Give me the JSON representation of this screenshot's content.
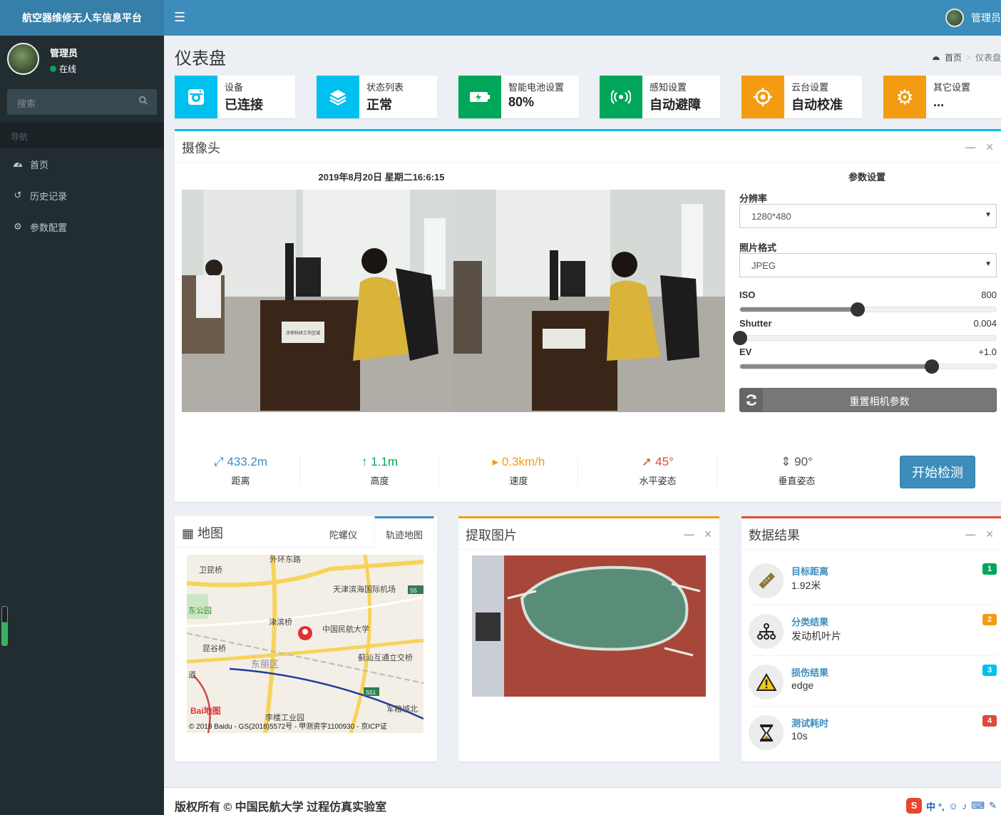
{
  "app": {
    "title": "航空器维修无人车信息平台"
  },
  "topbar": {
    "user_name": "管理员"
  },
  "sidebar": {
    "user_name": "管理员",
    "status": "在线",
    "search_placeholder": "搜索",
    "nav_header": "导航",
    "items": [
      {
        "label": "首页",
        "icon": "dashboard-icon"
      },
      {
        "label": "历史记录",
        "icon": "history-icon"
      },
      {
        "label": "参数配置",
        "icon": "cogs-icon"
      }
    ]
  },
  "page": {
    "title": "仪表盘",
    "breadcrumb": [
      "首页",
      "仪表盘"
    ]
  },
  "info_boxes": [
    {
      "label": "设备",
      "value": "已连接",
      "color": "#00c0ef",
      "icon": "camera-icon"
    },
    {
      "label": "状态列表",
      "value": "正常",
      "color": "#00c0ef",
      "icon": "layers-icon"
    },
    {
      "label": "智能电池设置",
      "value": "80%",
      "color": "#00a65a",
      "icon": "battery-icon"
    },
    {
      "label": "感知设置",
      "value": "自动避障",
      "color": "#00a65a",
      "icon": "broadcast-icon"
    },
    {
      "label": "云台设置",
      "value": "自动校准",
      "color": "#f39c12",
      "icon": "crosshair-icon"
    },
    {
      "label": "其它设置",
      "value": "...",
      "color": "#f39c12",
      "icon": "gear-icon"
    }
  ],
  "camera": {
    "title": "摄像头",
    "datetime": "2019年8月20日 星期二16:6:15",
    "params_title": "参数设置",
    "resolution_label": "分辨率",
    "resolution_value": "1280*480",
    "format_label": "照片格式",
    "format_value": "JPEG",
    "iso_label": "ISO",
    "iso_value": "800",
    "iso_fraction": 0.46,
    "shutter_label": "Shutter",
    "shutter_value": "0.004",
    "shutter_fraction": 0.0,
    "ev_label": "EV",
    "ev_value": "+1.0",
    "ev_fraction": 0.75,
    "reset_label": "重置相机参数",
    "sign_text": "涉密科研工作区域"
  },
  "stats": [
    {
      "value": "433.2m",
      "label": "距离",
      "color": "#3c8dbc",
      "icon": "expand-icon"
    },
    {
      "value": "1.1m",
      "label": "高度",
      "color": "#00a65a",
      "icon": "arrow-up-icon"
    },
    {
      "value": "0.3km/h",
      "label": "速度",
      "color": "#f39c12",
      "icon": "caret-right-icon"
    },
    {
      "value": "45°",
      "label": "水平姿态",
      "color": "#dd4b39",
      "icon": "location-arrow-icon"
    },
    {
      "value": "90°",
      "label": "垂直姿态",
      "color": "#555555",
      "icon": "sort-icon"
    }
  ],
  "start_button": "开始检测",
  "map_box": {
    "title": "地图",
    "tabs": [
      "陀螺仪",
      "轨迹地图"
    ],
    "labels": [
      "卫昆桥",
      "外环东路",
      "天津滨海国际机场",
      "东公园",
      "津滨桥",
      "中国民航大学",
      "昆谷桥",
      "东丽区",
      "蓟汕互通立交桥",
      "军粮城北",
      "李楼工业园",
      "道",
      "S5",
      "S51"
    ],
    "copyright": "© 2019 Baidu - GS(2018)5572号 - 甲测资字1100930 - 京ICP证",
    "logo_text": "Bai地图"
  },
  "extract_box": {
    "title": "提取图片"
  },
  "results_box": {
    "title": "数据结果",
    "items": [
      {
        "label": "目标距离",
        "value": "1.92米",
        "badge": "1",
        "badge_color": "#00a65a",
        "icon": "ruler-icon"
      },
      {
        "label": "分类结果",
        "value": "发动机叶片",
        "badge": "2",
        "badge_color": "#f39c12",
        "icon": "sitemap-icon"
      },
      {
        "label": "损伤结果",
        "value": "edge",
        "badge": "3",
        "badge_color": "#00c0ef",
        "icon": "warning-icon"
      },
      {
        "label": "测试耗时",
        "value": "10s",
        "badge": "4",
        "badge_color": "#dd4b39",
        "icon": "hourglass-icon"
      }
    ]
  },
  "footer": {
    "text": "版权所有 © 中国民航大学 过程仿真实验室"
  },
  "ime": {
    "text": "中 °,"
  }
}
